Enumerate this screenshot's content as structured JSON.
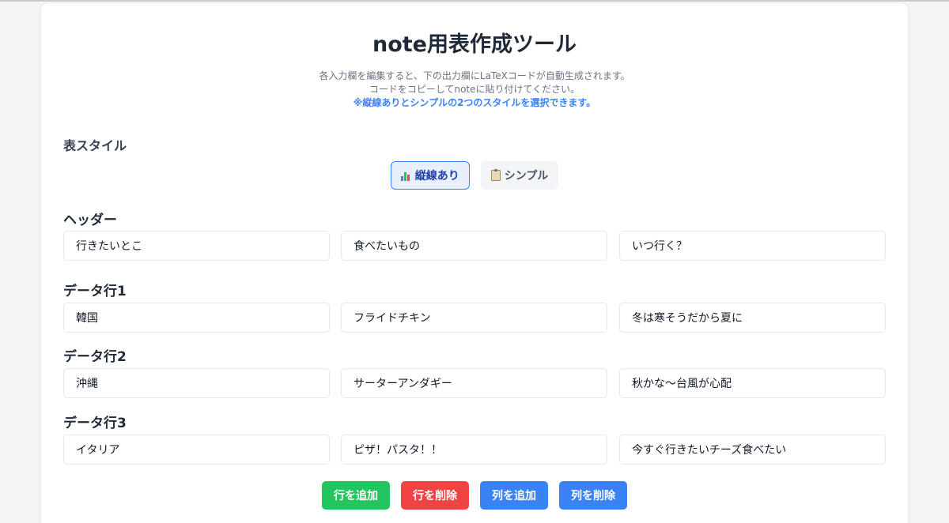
{
  "page": {
    "title": "note用表作成ツール",
    "desc_line1": "各入力欄を編集すると、下の出力欄にLaTeXコードが自動生成されます。",
    "desc_line2": "コードをコピーしてnoteに貼り付けてください。",
    "desc_note": "※縦線ありとシンプルの2つのスタイルを選択できます。"
  },
  "style_section": {
    "label": "表スタイル",
    "options": [
      {
        "label": "縦線あり",
        "icon": "bar-chart-icon",
        "selected": true
      },
      {
        "label": "シンプル",
        "icon": "clipboard-icon",
        "selected": false
      }
    ]
  },
  "table": {
    "header_label": "ヘッダー",
    "header": [
      "行きたいとこ",
      "食べたいもの",
      "いつ行く？"
    ],
    "rows": [
      {
        "label": "データ行1",
        "cells": [
          "韓国",
          "フライドチキン",
          "冬は寒そうだから夏に"
        ]
      },
      {
        "label": "データ行2",
        "cells": [
          "沖縄",
          "サーターアンダギー",
          "秋かな〜台風が心配"
        ]
      },
      {
        "label": "データ行3",
        "cells": [
          "イタリア",
          "ピザ！パスタ！！",
          "今すぐ行きたいチーズ食べたい"
        ]
      }
    ]
  },
  "actions": {
    "add_row": "行を追加",
    "delete_row": "行を削除",
    "add_col": "列を追加",
    "delete_col": "列を削除"
  },
  "colors": {
    "accent": "#3b82f6",
    "add_row": "#22c55e",
    "delete_row": "#ef4444",
    "column_buttons": "#3b82f6"
  }
}
